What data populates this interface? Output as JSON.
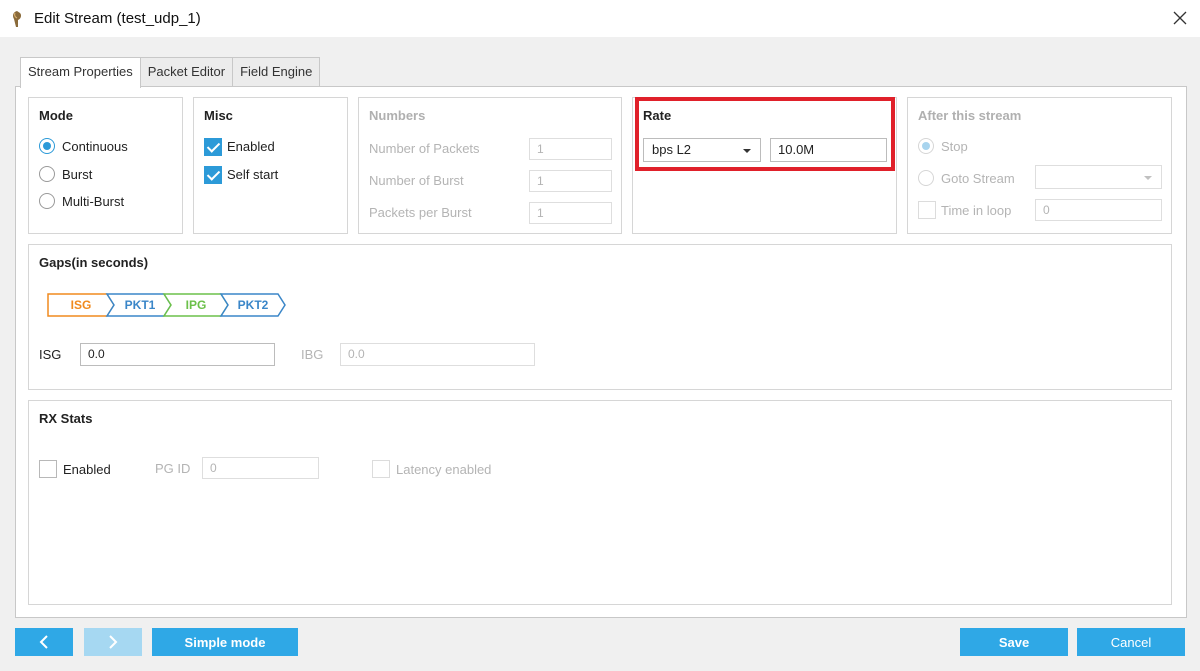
{
  "window": {
    "title": "Edit Stream (test_udp_1)"
  },
  "tabs": [
    "Stream Properties",
    "Packet Editor",
    "Field Engine"
  ],
  "mode": {
    "title": "Mode",
    "options": [
      "Continuous",
      "Burst",
      "Multi-Burst"
    ],
    "selected": "Continuous"
  },
  "misc": {
    "title": "Misc",
    "enabled_label": "Enabled",
    "self_start_label": "Self start"
  },
  "numbers": {
    "title": "Numbers",
    "packets_label": "Number of Packets",
    "packets_value": "1",
    "burst_label": "Number of Burst",
    "burst_value": "1",
    "ppb_label": "Packets per Burst",
    "ppb_value": "1"
  },
  "rate": {
    "title": "Rate",
    "type": "bps L2",
    "value": "10.0M"
  },
  "after": {
    "title": "After this stream",
    "stop_label": "Stop",
    "goto_label": "Goto Stream",
    "loop_label": "Time in loop",
    "loop_value": "0"
  },
  "gaps": {
    "title": "Gaps(in seconds)",
    "chevrons": [
      "ISG",
      "PKT1",
      "IPG",
      "PKT2"
    ],
    "isg_label": "ISG",
    "isg_value": "0.0",
    "ibg_label": "IBG",
    "ibg_value": "0.0"
  },
  "colors": {
    "isg": "#f08a1e",
    "pkt": "#3a86c8",
    "ipg": "#6cc04a",
    "accent": "#2fa8e6",
    "highlight": "#e0202a"
  },
  "rx": {
    "title": "RX Stats",
    "enabled_label": "Enabled",
    "pgid_label": "PG ID",
    "pgid_value": "0",
    "latency_label": "Latency enabled"
  },
  "buttons": {
    "simple_mode": "Simple mode",
    "save": "Save",
    "cancel": "Cancel"
  }
}
